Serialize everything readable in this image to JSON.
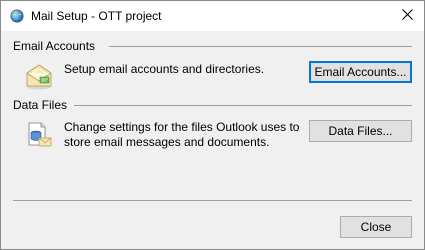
{
  "window": {
    "title": "Mail Setup - OTT project",
    "title_icon": "mail-setup-globe-icon",
    "close_icon": "close-icon"
  },
  "email_accounts": {
    "heading": "Email Accounts",
    "description": "Setup email accounts and directories.",
    "button_label": "Email Accounts...",
    "icon": "email-accounts-icon"
  },
  "data_files": {
    "heading": "Data Files",
    "description": "Change settings for the files Outlook uses to store email messages and documents.",
    "button_label": "Data Files...",
    "icon": "data-files-icon"
  },
  "footer": {
    "close_label": "Close"
  },
  "colors": {
    "accent": "#0078d7",
    "dialog_bg": "#f0f0f0",
    "button_bg": "#e1e1e1"
  }
}
